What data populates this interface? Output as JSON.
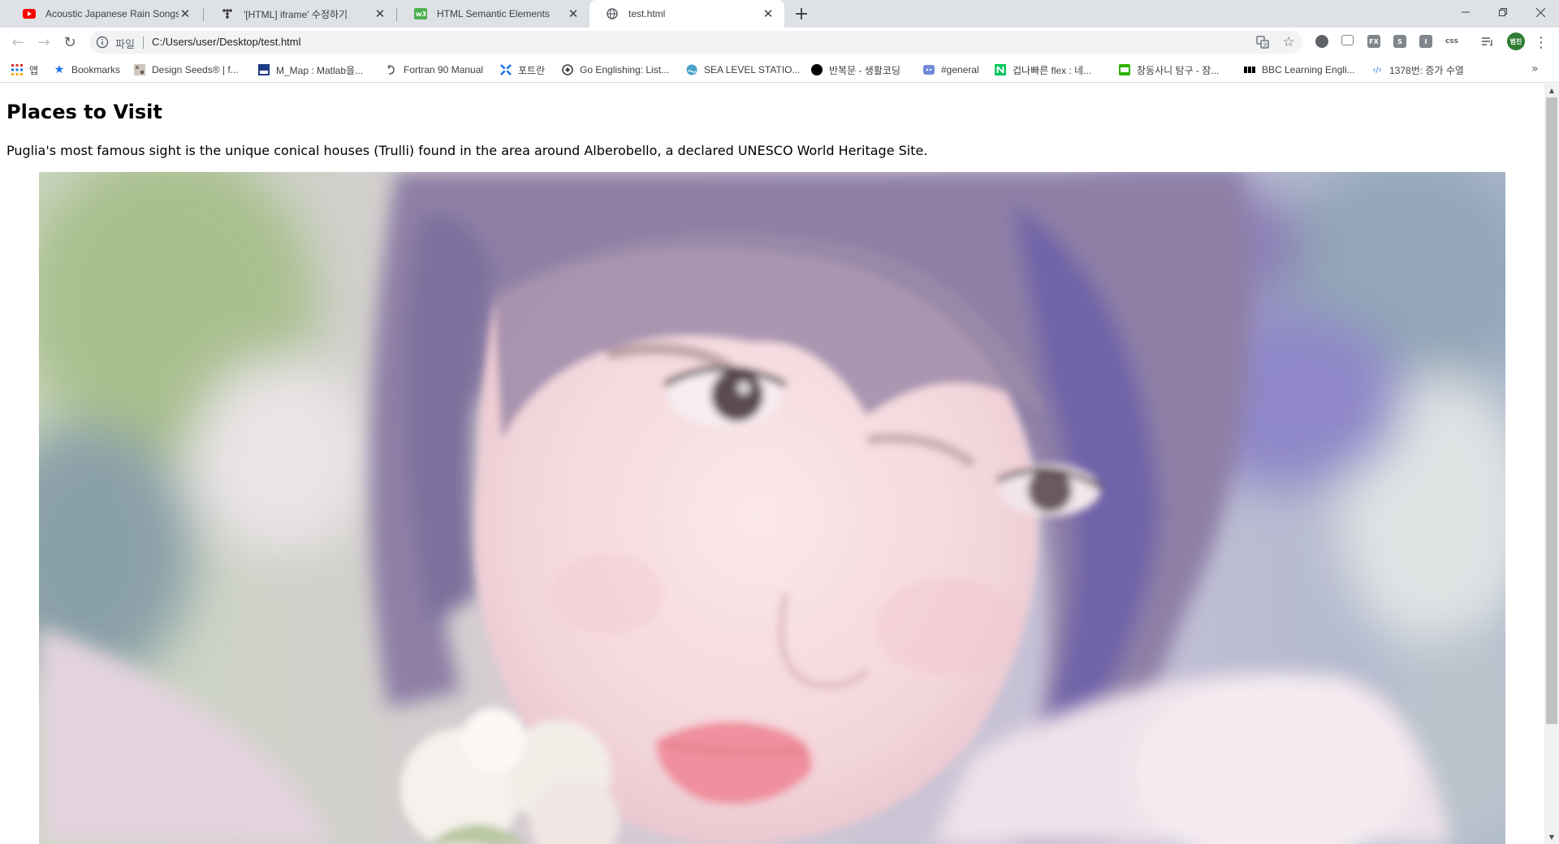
{
  "browser": {
    "tabs": [
      {
        "title": "Acoustic Japanese Rain Songs -",
        "favicon": "youtube-icon",
        "active": false
      },
      {
        "title": "'[HTML] iframe' 수정하기",
        "favicon": "tistory-icon",
        "active": false
      },
      {
        "title": "HTML Semantic Elements",
        "favicon": "w3schools-icon",
        "active": false
      },
      {
        "title": "test.html",
        "favicon": "globe-icon",
        "active": true
      }
    ],
    "new_tab_glyph": "+",
    "window_controls": {
      "minimize": "—",
      "maximize": "❐",
      "close": "✕"
    }
  },
  "toolbar": {
    "back": "←",
    "forward": "→",
    "reload": "↻",
    "scheme_label": "파일",
    "url": "C:/Users/user/Desktop/test.html",
    "translate_icon": "translate-icon",
    "bookmark_star": "☆",
    "extensions": [
      {
        "name": "extension-circle-icon",
        "label": "",
        "color": "#5f6368"
      },
      {
        "name": "extension-screen-icon",
        "label": "",
        "color": "#80868b"
      },
      {
        "name": "extension-fx-icon",
        "label": "FX",
        "color": "#80868b"
      },
      {
        "name": "extension-s-icon",
        "label": "S",
        "color": "#80868b"
      },
      {
        "name": "extension-i-icon",
        "label": "I",
        "color": "#80868b"
      },
      {
        "name": "extension-css-icon",
        "label": "css",
        "color": "#ffffff"
      }
    ],
    "reading_list_icon": "reading-list-icon",
    "profile_label": "범진",
    "menu_glyph": "⋮"
  },
  "bookmarks": [
    {
      "label": "앱",
      "icon": "apps-grid-icon"
    },
    {
      "label": "Bookmarks",
      "icon": "star-icon"
    },
    {
      "label": "Design Seeds® | f...",
      "icon": "design-seeds-icon"
    },
    {
      "label": "M_Map : Matlab을...",
      "icon": "mmap-icon"
    },
    {
      "label": "Fortran 90 Manual",
      "icon": "fortran-icon"
    },
    {
      "label": "포트란",
      "icon": "tool-icon"
    },
    {
      "label": "Go Englishing: List...",
      "icon": "go-englishing-icon"
    },
    {
      "label": "SEA LEVEL STATIO...",
      "icon": "sea-level-icon"
    },
    {
      "label": "반복문 - 생활코딩",
      "icon": "black-circle-icon"
    },
    {
      "label": "#general",
      "icon": "discord-icon"
    },
    {
      "label": "겁나빠른 flex : 네...",
      "icon": "naver-icon"
    },
    {
      "label": "창동사니 탐구 - 잠...",
      "icon": "blog-icon"
    },
    {
      "label": "BBC Learning Engli...",
      "icon": "bbc-icon"
    },
    {
      "label": "1378번: 증가 수열",
      "icon": "code-brackets-icon"
    }
  ],
  "bookmarks_overflow": "»",
  "page": {
    "heading": "Places to Visit",
    "paragraph": "Puglia's most famous sight is the unique conical houses (Trulli) found in the area around Alberobello, a declared UNESCO World Heritage Site.",
    "image": "portrait-photo"
  },
  "scrollbar": {
    "up": "▲",
    "down": "▼",
    "position": 0.0
  }
}
